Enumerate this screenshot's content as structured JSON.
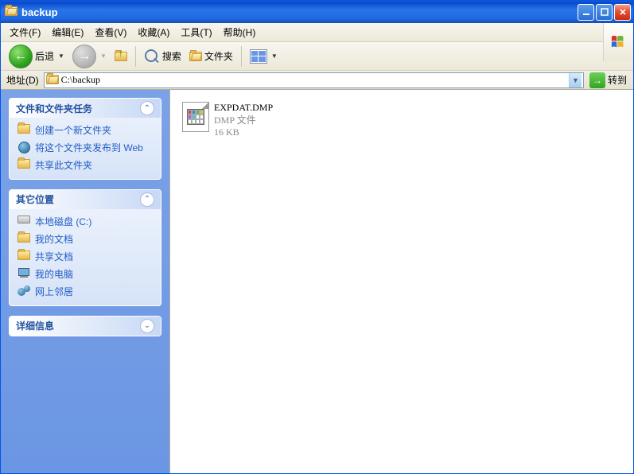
{
  "title": "backup",
  "menu": {
    "file": "文件(F)",
    "edit": "编辑(E)",
    "view": "查看(V)",
    "favorites": "收藏(A)",
    "tools": "工具(T)",
    "help": "帮助(H)"
  },
  "toolbar": {
    "back": "后退",
    "search": "搜索",
    "folders": "文件夹"
  },
  "address": {
    "label": "地址(D)",
    "value": "C:\\backup",
    "go": "转到"
  },
  "sidebar": {
    "panel1": {
      "title": "文件和文件夹任务",
      "items": [
        "创建一个新文件夹",
        "将这个文件夹发布到 Web",
        "共享此文件夹"
      ]
    },
    "panel2": {
      "title": "其它位置",
      "items": [
        "本地磁盘 (C:)",
        "我的文档",
        "共享文档",
        "我的电脑",
        "网上邻居"
      ]
    },
    "panel3": {
      "title": "详细信息"
    }
  },
  "file": {
    "name": "EXPDAT.DMP",
    "type": "DMP 文件",
    "size": "16 KB"
  }
}
